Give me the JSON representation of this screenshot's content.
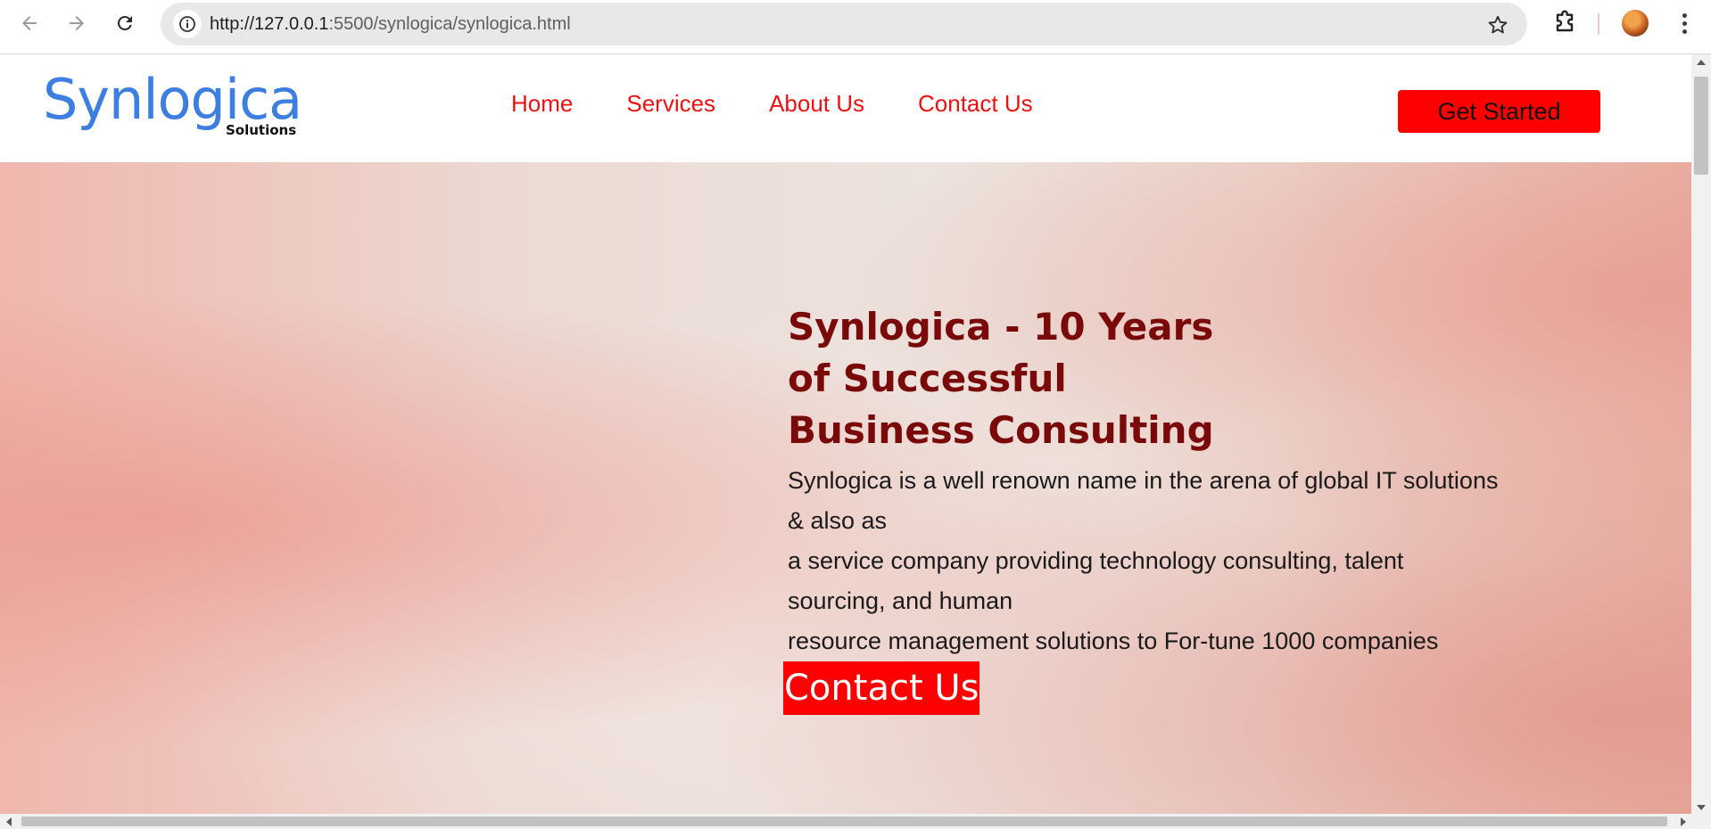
{
  "browser": {
    "url_host": "http://127.0.0.1",
    "url_rest": ":5500/synlogica/synlogica.html",
    "icons": {
      "back": "arrow-left-icon",
      "forward": "arrow-right-icon",
      "reload": "reload-icon",
      "site_info": "info-icon",
      "bookmark": "star-icon",
      "extensions": "puzzle-icon",
      "profile": "avatar",
      "menu": "more-vertical-icon"
    }
  },
  "header": {
    "logo_main": "Synlogica",
    "logo_sub": "Solutions",
    "nav": [
      {
        "label": "Home"
      },
      {
        "label": "Services"
      },
      {
        "label": "About Us"
      },
      {
        "label": "Contact Us"
      }
    ],
    "cta_label": "Get Started"
  },
  "hero": {
    "title_lines": [
      "Synlogica - 10 Years",
      "of Successful",
      "Business Consulting"
    ],
    "description_lines": [
      "Synlogica is a well renown name in the arena of global IT solutions",
      "& also as",
      "a service company providing technology consulting, talent",
      "sourcing, and human",
      "resource management solutions to For-tune 1000 companies"
    ],
    "cta_label": "Contact Us"
  },
  "colors": {
    "logo": "#3d7fe0",
    "nav_link": "#ee1111",
    "button_bg": "#ff0000",
    "hero_title": "#7a0a0a"
  }
}
